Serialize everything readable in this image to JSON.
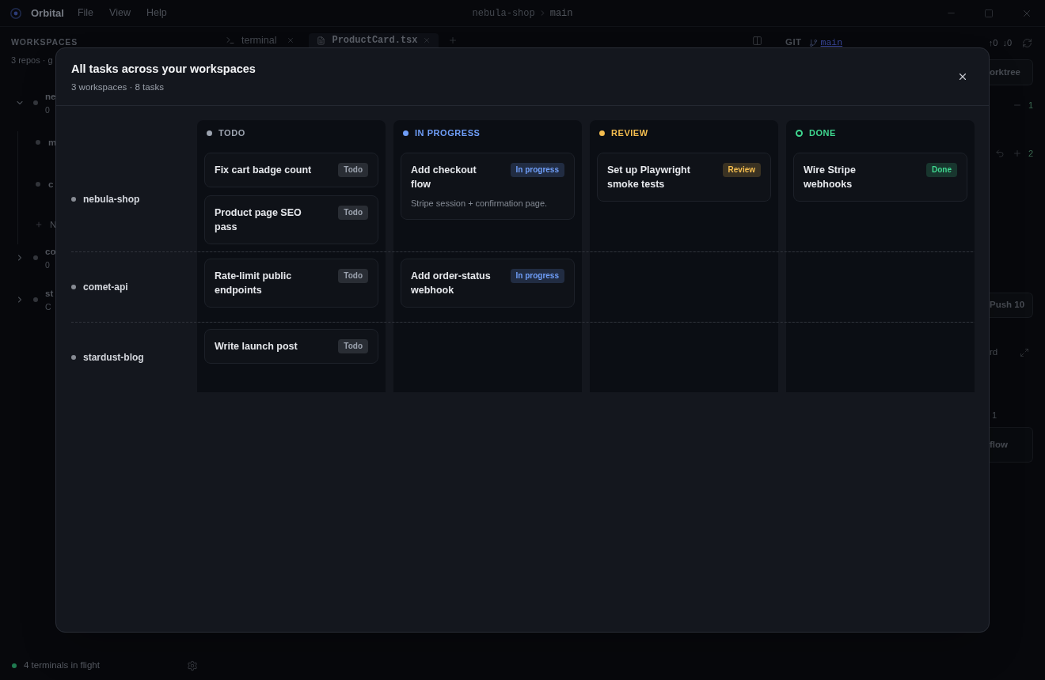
{
  "app": {
    "name": "Orbital",
    "menu": [
      "File",
      "View",
      "Help"
    ],
    "breadcrumb": {
      "repo": "nebula-shop",
      "branch": "main"
    }
  },
  "sidebar": {
    "title": "WORKSPACES",
    "summary": "3 repos · g",
    "workspaces": [
      {
        "name": "ne",
        "detail": "0",
        "expanded": true,
        "children": [
          {
            "name": "m"
          },
          {
            "name": "c"
          }
        ],
        "add_label": "N"
      },
      {
        "name": "co",
        "detail": "0",
        "expanded": false
      },
      {
        "name": "st",
        "detail": "C",
        "expanded": false
      }
    ],
    "status": "4 terminals in flight"
  },
  "editor": {
    "tabs": [
      {
        "kind": "terminal",
        "label": "terminal",
        "selected": false
      },
      {
        "kind": "file",
        "label": "ProductCard.tsx",
        "selected": true
      }
    ]
  },
  "git": {
    "title": "GIT",
    "branch": "main",
    "ahead": "↑0",
    "behind": "↓0",
    "worktree_button": "orktree",
    "changes": [
      {
        "kind": "minus",
        "count": "1"
      },
      {
        "kind": "plus",
        "count": "2"
      }
    ],
    "push_button": "Push 10",
    "section_label": "rd",
    "note": "1",
    "card": "flow"
  },
  "modal": {
    "title": "All tasks across your workspaces",
    "subtitle": "3 workspaces · 8 tasks",
    "columns": [
      {
        "label": "TODO",
        "color": "#9ca3af",
        "kind": "dot"
      },
      {
        "label": "IN PROGRESS",
        "color": "#6f9ef8",
        "kind": "dot"
      },
      {
        "label": "REVIEW",
        "color": "#f4bd4f",
        "kind": "dot"
      },
      {
        "label": "DONE",
        "color": "#3fd68f",
        "kind": "ring"
      }
    ],
    "lanes": [
      {
        "name": "nebula-shop",
        "cells": [
          {
            "tasks": [
              {
                "title": "Fix cart badge count",
                "badge": "Todo"
              },
              {
                "title": "Product page SEO pass",
                "badge": "Todo"
              }
            ]
          },
          {
            "tasks": [
              {
                "title": "Add checkout flow",
                "badge": "In progress",
                "description": "Stripe session + confirmation page."
              }
            ]
          },
          {
            "tasks": [
              {
                "title": "Set up Playwright smoke tests",
                "badge": "Review"
              }
            ]
          },
          {
            "tasks": [
              {
                "title": "Wire Stripe webhooks",
                "badge": "Done"
              }
            ]
          }
        ]
      },
      {
        "name": "comet-api",
        "cells": [
          {
            "tasks": [
              {
                "title": "Rate-limit public endpoints",
                "badge": "Todo"
              }
            ]
          },
          {
            "tasks": [
              {
                "title": "Add order-status webhook",
                "badge": "In progress"
              }
            ]
          },
          {},
          {}
        ]
      },
      {
        "name": "stardust-blog",
        "cells": [
          {
            "tasks": [
              {
                "title": "Write launch post",
                "badge": "Todo"
              }
            ]
          },
          {},
          {},
          {}
        ]
      }
    ]
  }
}
